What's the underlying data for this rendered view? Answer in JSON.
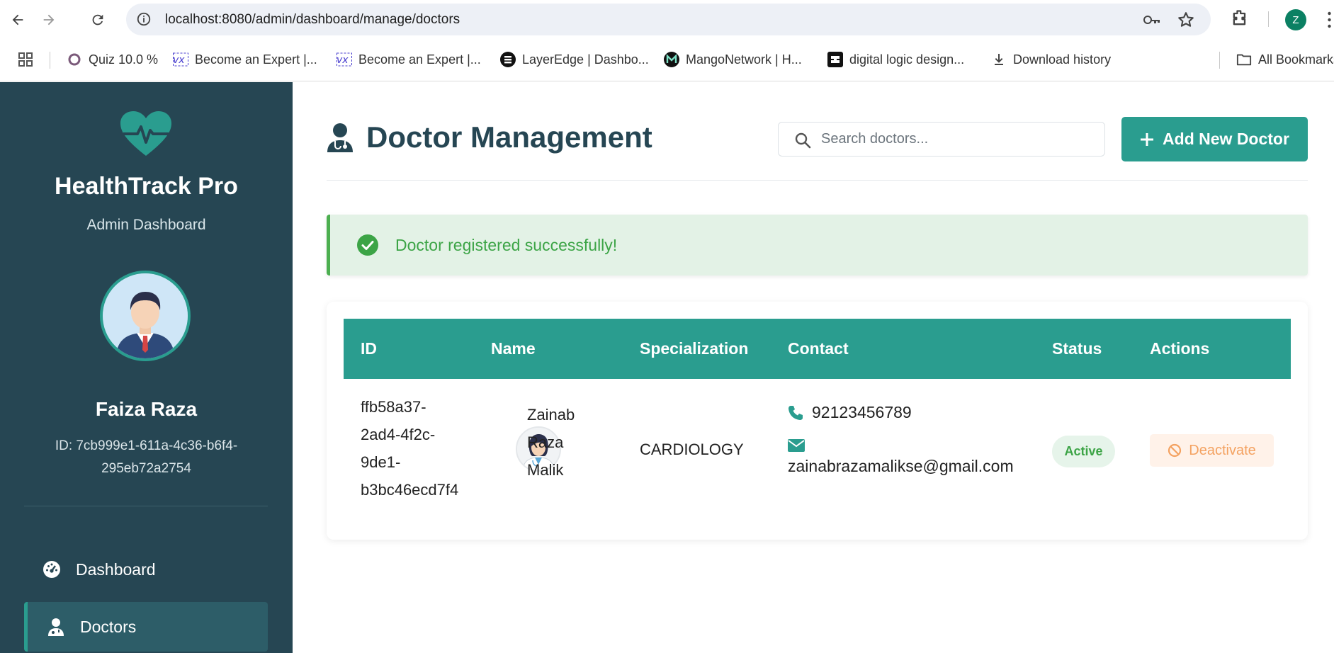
{
  "browser": {
    "url": "localhost:8080/admin/dashboard/manage/doctors",
    "profile_initial": "Z",
    "bookmarks": [
      {
        "label": "Quiz 10.0 %",
        "icon": "circle-quiz-icon"
      },
      {
        "label": "Become an Expert |...",
        "icon": "vx-icon"
      },
      {
        "label": "Become an Expert |...",
        "icon": "vx-icon"
      },
      {
        "label": "LayerEdge | Dashbo...",
        "icon": "layeredge-icon"
      },
      {
        "label": "MangoNetwork | H...",
        "icon": "mango-icon"
      },
      {
        "label": "digital logic design...",
        "icon": "dld-icon"
      },
      {
        "label": "Download history",
        "icon": "download-icon"
      }
    ],
    "all_bookmarks": "All Bookmarks"
  },
  "sidebar": {
    "brand_title": "HealthTrack Pro",
    "brand_subtitle": "Admin Dashboard",
    "user_name": "Faiza Raza",
    "user_id": "ID: 7cb999e1-611a-4c36-b6f4-295eb72a2754",
    "nav": [
      {
        "label": "Dashboard",
        "icon": "dashboard-gauge-icon",
        "active": false
      },
      {
        "label": "Doctors",
        "icon": "doctor-icon",
        "active": true
      }
    ]
  },
  "header": {
    "title": "Doctor Management",
    "search_placeholder": "Search doctors...",
    "add_button": "Add New Doctor"
  },
  "alert": {
    "message": "Doctor registered successfully!"
  },
  "table": {
    "columns": [
      "ID",
      "Name",
      "Specialization",
      "Contact",
      "Status",
      "Actions"
    ],
    "rows": [
      {
        "id_lines": [
          "ffb58a37-",
          "2ad4-4f2c-",
          "9de1-",
          "b3bc46ecd7f4"
        ],
        "name_lines": [
          "Zainab",
          "Raza",
          "Malik"
        ],
        "specialization": "CARDIOLOGY",
        "phone": "92123456789",
        "email": "zainabrazamalikse@gmail.com",
        "status": "Active",
        "action": "Deactivate"
      }
    ]
  },
  "colors": {
    "sidebar_bg": "#264653",
    "accent": "#2a9d8f",
    "success": "#4caf50",
    "warning": "#f4a261"
  }
}
